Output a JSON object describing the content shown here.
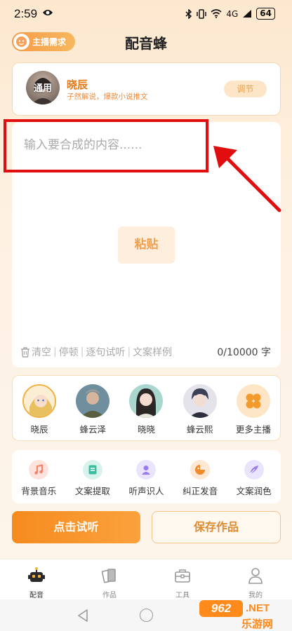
{
  "status": {
    "time": "2:59",
    "network": "4G",
    "battery": "64"
  },
  "header": {
    "anchor_button_label": "主播需求",
    "title": "配音蜂"
  },
  "voice": {
    "avatar_tag": "通用",
    "name": "晓辰",
    "desc": "子然解说，爆款小说推文",
    "adjust_label": "调节"
  },
  "editor": {
    "placeholder": "输入要合成的内容......",
    "paste_label": "粘贴",
    "tools": [
      "清空",
      "停顿",
      "逐句试听",
      "文案样例"
    ],
    "char_count": "0/10000 字"
  },
  "anchors": {
    "items": [
      {
        "name": "晓辰",
        "selected": true
      },
      {
        "name": "蜂云泽",
        "selected": false
      },
      {
        "name": "晓晓",
        "selected": false
      },
      {
        "name": "蜂云熙",
        "selected": false
      }
    ],
    "more_label": "更多主播"
  },
  "tools": [
    {
      "label": "背景音乐",
      "icon": "music-icon",
      "color": "#f7806a"
    },
    {
      "label": "文案提取",
      "icon": "extract-icon",
      "color": "#3bbf9f"
    },
    {
      "label": "听声识人",
      "icon": "person-icon",
      "color": "#9a7bf0"
    },
    {
      "label": "纠正发音",
      "icon": "pronounce-icon",
      "color": "#f08a2a"
    },
    {
      "label": "文案润色",
      "icon": "polish-icon",
      "color": "#9a7bf0"
    }
  ],
  "actions": {
    "listen_label": "点击试听",
    "save_label": "保存作品"
  },
  "tabs": [
    {
      "label": "配音",
      "icon": "robot-icon",
      "active": true
    },
    {
      "label": "作品",
      "icon": "works-icon",
      "active": false
    },
    {
      "label": "工具",
      "icon": "toolbox-icon",
      "active": false
    },
    {
      "label": "我的",
      "icon": "profile-icon",
      "active": false
    }
  ],
  "watermark": {
    "badge": "962",
    "suffix": ".NET",
    "sub": "乐游网"
  },
  "colors": {
    "accent": "#f68b1f",
    "highlight": "#e00e0e"
  }
}
